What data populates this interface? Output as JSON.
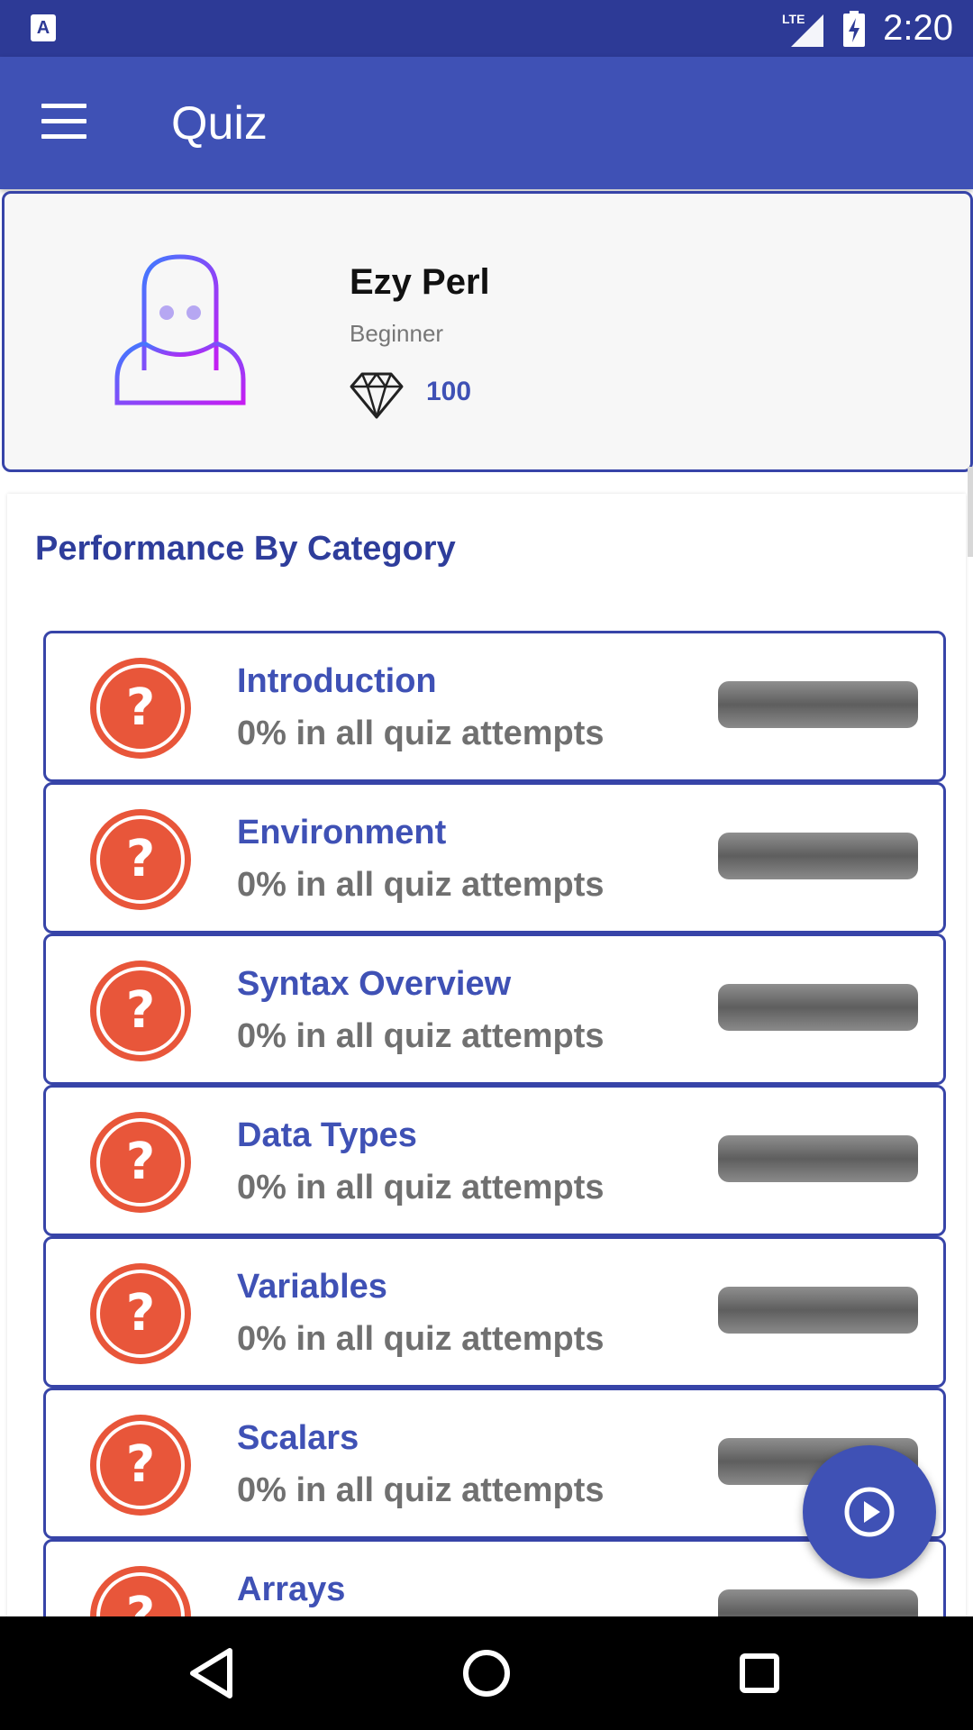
{
  "status_bar": {
    "notification_icon": "text-a-icon",
    "network_label": "LTE",
    "time": "2:20"
  },
  "app_bar": {
    "menu_icon": "hamburger-menu-icon",
    "title": "Quiz"
  },
  "profile": {
    "name": "Ezy Perl",
    "level": "Beginner",
    "gems_icon": "diamond-icon",
    "gems": "100"
  },
  "performance": {
    "title": "Performance By Category",
    "categories": [
      {
        "name": "Introduction",
        "summary": "0% in all quiz attempts",
        "progress": 0
      },
      {
        "name": "Environment",
        "summary": "0% in all quiz attempts",
        "progress": 0
      },
      {
        "name": "Syntax Overview",
        "summary": "0% in all quiz attempts",
        "progress": 0
      },
      {
        "name": "Data Types",
        "summary": "0% in all quiz attempts",
        "progress": 0
      },
      {
        "name": "Variables",
        "summary": "0% in all quiz attempts",
        "progress": 0
      },
      {
        "name": "Scalars",
        "summary": "0% in all quiz attempts",
        "progress": 0
      },
      {
        "name": "Arrays",
        "summary": "",
        "progress": 0
      }
    ]
  },
  "fab": {
    "icon": "play-circle-icon"
  },
  "colors": {
    "primary": "#3f51b5",
    "primary_dark": "#2d3a96",
    "accent_red": "#e8563a",
    "subtext_gray": "#707070"
  }
}
